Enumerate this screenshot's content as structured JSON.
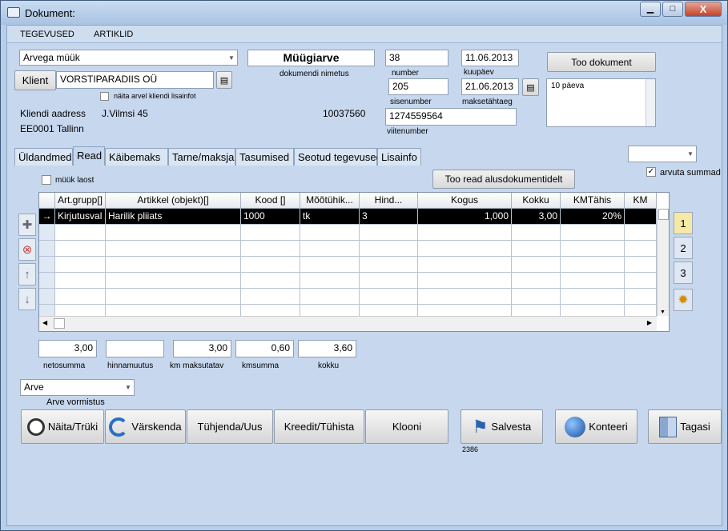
{
  "window": {
    "title": "Dokument:",
    "min": "▁",
    "max": "□",
    "close": "X"
  },
  "menu": [
    "TEGEVUSED",
    "ARTIKLID"
  ],
  "doc_type": "Arvega müük",
  "client_btn": "Klient",
  "client_name": "VORSTIPARADIIS OÜ",
  "show_client_info": "näita arvel kliendi lisainfot",
  "address_label": "Kliendi aadress",
  "address_street": "J.Vilmsi 45",
  "address_city": "EE0001 Tallinn",
  "reg_code": "10037560",
  "doc_name": "Müügiarve",
  "doc_name_label": "dokumendi nimetus",
  "number": "38",
  "number_label": "number",
  "date": "11.06.2013",
  "date_label": "kuupäev",
  "inner_number": "205",
  "inner_number_label": "sisenumber",
  "due_date": "21.06.2013",
  "due_date_label": "maksetähtaeg",
  "ref_number": "1274559564",
  "ref_number_label": "viitenumber",
  "fetch_doc": "Too dokument",
  "payment_terms": "10 päeva",
  "tabs": [
    "Üldandmed",
    "Read",
    "Käibemaks",
    "Tarne/maksja",
    "Tasumised",
    "Seotud tegevused",
    "Lisainfo"
  ],
  "sell_from_stock": "müük laost",
  "fetch_rows": "Too read alusdokumentidelt",
  "calc_sums": "arvuta summad",
  "columns": [
    "Art.grupp[]",
    "Artikkel (objekt)[]",
    "Kood []",
    "Mõõtühik...",
    "Hind...",
    "Kogus",
    "Kokku",
    "KMTähis",
    "KM"
  ],
  "row": {
    "marker": "→",
    "group": "Kirjutusval",
    "article": "Harilik pliiats",
    "code": "1000",
    "unit": "tk",
    "price": "3",
    "qty": "1,000",
    "total": "3,00",
    "vat": "20%"
  },
  "pages": [
    "1",
    "2",
    "3"
  ],
  "sums": [
    {
      "value": "3,00",
      "label": "netosumma"
    },
    {
      "value": "",
      "label": "hinnamuutus"
    },
    {
      "value": "3,00",
      "label": "km maksutatav"
    },
    {
      "value": "0,60",
      "label": "kmsumma"
    },
    {
      "value": "3,60",
      "label": "kokku"
    }
  ],
  "format_value": "Arve",
  "format_label": "Arve vormistus",
  "buttons": {
    "print": "Näita/Trüki",
    "refresh": "Värskenda",
    "clear": "Tühjenda/Uus",
    "credit": "Kreedit/Tühista",
    "clone": "Klooni",
    "save": "Salvesta",
    "post": "Konteeri",
    "back": "Tagasi"
  },
  "save_sub": "2386"
}
